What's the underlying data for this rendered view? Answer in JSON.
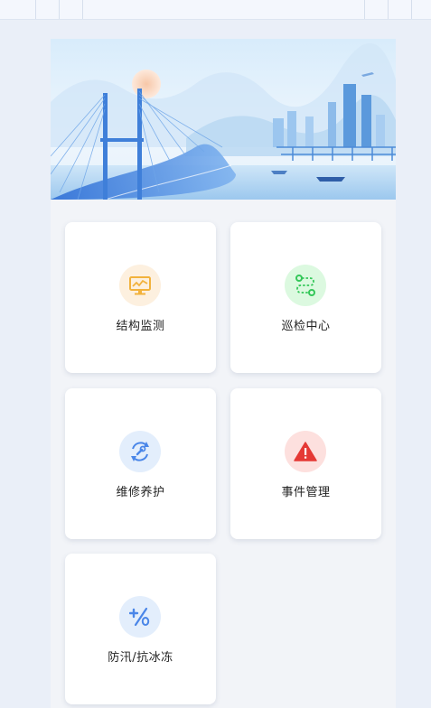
{
  "menu": {
    "items": [
      {
        "id": "structure",
        "label": "结构监测",
        "icon": "monitor-chart-icon",
        "bg": "#fdf0df",
        "color": "#f2b23c"
      },
      {
        "id": "patrol",
        "label": "巡检中心",
        "icon": "route-icon",
        "bg": "#dcf9e0",
        "color": "#34c759"
      },
      {
        "id": "maintenance",
        "label": "维修养护",
        "icon": "wrench-refresh-icon",
        "bg": "#e3eefc",
        "color": "#4a86e8"
      },
      {
        "id": "events",
        "label": "事件管理",
        "icon": "warning-icon",
        "bg": "#fde0de",
        "color": "#e53935"
      },
      {
        "id": "flood",
        "label": "防汛/抗冰冻",
        "icon": "percent-icon",
        "bg": "#e3eefc",
        "color": "#4a86e8"
      }
    ]
  },
  "colors": {
    "page_bg": "#eaeff8",
    "panel_bg": "#f2f4f8",
    "card_bg": "#ffffff"
  }
}
